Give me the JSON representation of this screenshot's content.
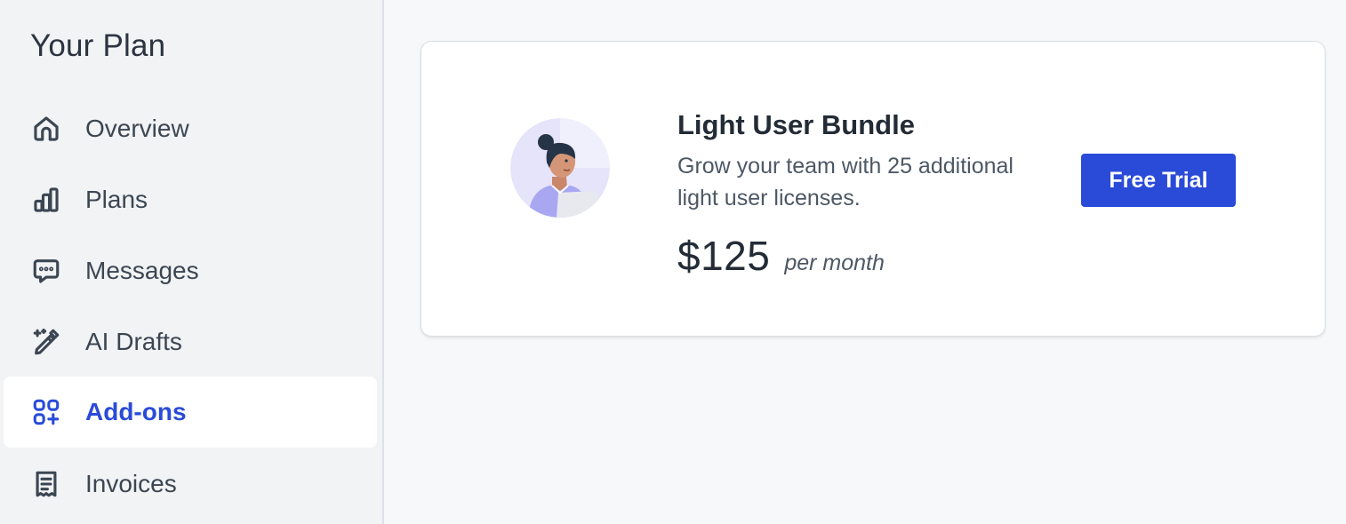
{
  "sidebar": {
    "title": "Your Plan",
    "items": [
      {
        "label": "Overview",
        "icon": "home-icon",
        "active": false
      },
      {
        "label": "Plans",
        "icon": "bar-chart-icon",
        "active": false
      },
      {
        "label": "Messages",
        "icon": "chat-bubble-icon",
        "active": false
      },
      {
        "label": "AI Drafts",
        "icon": "magic-pencil-icon",
        "active": false
      },
      {
        "label": "Add-ons",
        "icon": "grid-plus-icon",
        "active": true
      },
      {
        "label": "Invoices",
        "icon": "receipt-icon",
        "active": false
      }
    ]
  },
  "addon_card": {
    "title": "Light User Bundle",
    "description": "Grow your team with 25 additional light user licenses.",
    "price": "$125",
    "period": "per month",
    "button_label": "Free Trial",
    "avatar_icon": "person-illustration"
  },
  "colors": {
    "accent": "#2a4bd8",
    "sidebar_bg": "#f1f3f5",
    "page_bg": "#f7f8f9",
    "text": "#2b3440"
  }
}
